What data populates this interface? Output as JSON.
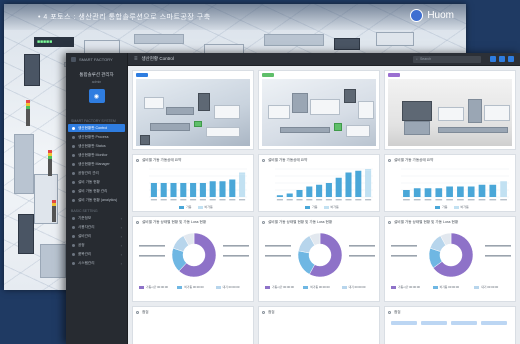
{
  "back_window": {
    "title": "• 4 포토스 : 생산관리 통합솔루션으로 스마트공장 구축",
    "logo_text": "Huom",
    "machine_label": "■■■■■"
  },
  "app": {
    "sidebar": {
      "top_label": "SMART FACTORY",
      "profile_title": "통합솔루션 관리자",
      "profile_sub": "admin",
      "section_1": "SMART FACTORY SYSTEM",
      "items": [
        {
          "label": "생산현황판 Control",
          "active": true
        },
        {
          "label": "생산현황판 Process",
          "active": false
        },
        {
          "label": "생산현황판 Status",
          "active": false
        },
        {
          "label": "생산현황판 Monitor",
          "active": false
        },
        {
          "label": "생산현황판 Manager",
          "active": false
        },
        {
          "label": "공정관리 관리",
          "active": false
        },
        {
          "label": "설비 가동 현황",
          "active": false
        },
        {
          "label": "설비 가동 현황 관리",
          "active": false
        },
        {
          "label": "설비 가동 현황 (analytics)",
          "active": false
        }
      ],
      "section_2": "BASIC SETTING",
      "items_2": [
        {
          "label": "기준정보"
        },
        {
          "label": "사용자관리"
        },
        {
          "label": "설비관리"
        },
        {
          "label": "공정"
        },
        {
          "label": "품목관리"
        },
        {
          "label": "시스템관리"
        }
      ]
    },
    "topbar": {
      "menu_icon": "hamburger-icon",
      "title": "생산현황 Control",
      "search_placeholder": "Search",
      "icon_colors": [
        "#2f7de0",
        "#2f7de0",
        "#2f7de0"
      ]
    },
    "panels": {
      "photos": [
        {
          "tag_color": "#2f7de0"
        },
        {
          "tag_color": "#5fbf6a"
        },
        {
          "tag_color": "#9b6fd1"
        }
      ],
      "bar_titles": [
        "설비별 가동 가동상태 요약",
        "설비별 가동 가동상태 요약",
        "설비별 가동 가동상태 요약"
      ],
      "bar_legend": [
        [
          "가동",
          "비가동"
        ],
        [
          "가동",
          "비가동"
        ],
        [
          "가동",
          "비가동"
        ]
      ],
      "donut_titles": [
        "설비별 가동 상태별 현황 및 가동 Loss 현황",
        "설비별 가동 상태별 현황 및 가동 Loss 현황",
        "설비별 가동 상태별 현황 및 가동 Loss 현황"
      ],
      "donut_labels": [
        "가동시간 00:00:00",
        "비가동 00:00:00",
        "대기 00:00:00",
        "가동시간 00:00:00 (00%)"
      ],
      "bottom_titles": [
        "점검",
        "점검",
        "점검"
      ]
    },
    "colors": {
      "accent": "#2f7de0",
      "bar_primary": "#4aa7d8",
      "bar_light": "#c2e1f2",
      "donut_1": "#8e72c8",
      "donut_2": "#6fb7e3",
      "donut_3": "#b7d5ec",
      "donut_4": "#e2e8ef"
    }
  },
  "chart_data": [
    {
      "type": "bar",
      "categories": [
        "",
        "",
        "",
        "",
        "",
        "",
        "",
        "",
        "",
        ""
      ],
      "series": [
        {
          "values": [
            8,
            8,
            8,
            8,
            8,
            8,
            9,
            9,
            10,
            13
          ]
        },
        {
          "values": [
            0,
            0,
            0,
            0,
            0,
            0,
            0,
            0,
            0,
            1
          ]
        }
      ],
      "ylim": [
        0,
        16
      ]
    },
    {
      "type": "bar",
      "categories": [
        "",
        "",
        "",
        "",
        "",
        "",
        "",
        "",
        "",
        ""
      ],
      "series": [
        {
          "values": [
            1,
            2,
            4,
            6,
            7,
            8,
            11,
            14,
            15,
            15
          ]
        },
        {
          "values": [
            0,
            0,
            0,
            0,
            0,
            0,
            0,
            0,
            0,
            1
          ]
        }
      ],
      "ylim": [
        0,
        16
      ]
    },
    {
      "type": "bar",
      "categories": [
        "",
        "",
        "",
        "",
        "",
        "",
        "",
        "",
        "",
        ""
      ],
      "series": [
        {
          "values": [
            4,
            5,
            5,
            5,
            6,
            6,
            6,
            7,
            7,
            8
          ]
        },
        {
          "values": [
            0,
            0,
            0,
            0,
            0,
            0,
            0,
            0,
            0,
            1
          ]
        }
      ],
      "ylim": [
        0,
        16
      ]
    },
    {
      "type": "pie",
      "values": [
        62,
        18,
        12,
        8
      ]
    },
    {
      "type": "pie",
      "values": [
        58,
        20,
        14,
        8
      ]
    },
    {
      "type": "pie",
      "values": [
        65,
        15,
        12,
        8
      ]
    }
  ]
}
